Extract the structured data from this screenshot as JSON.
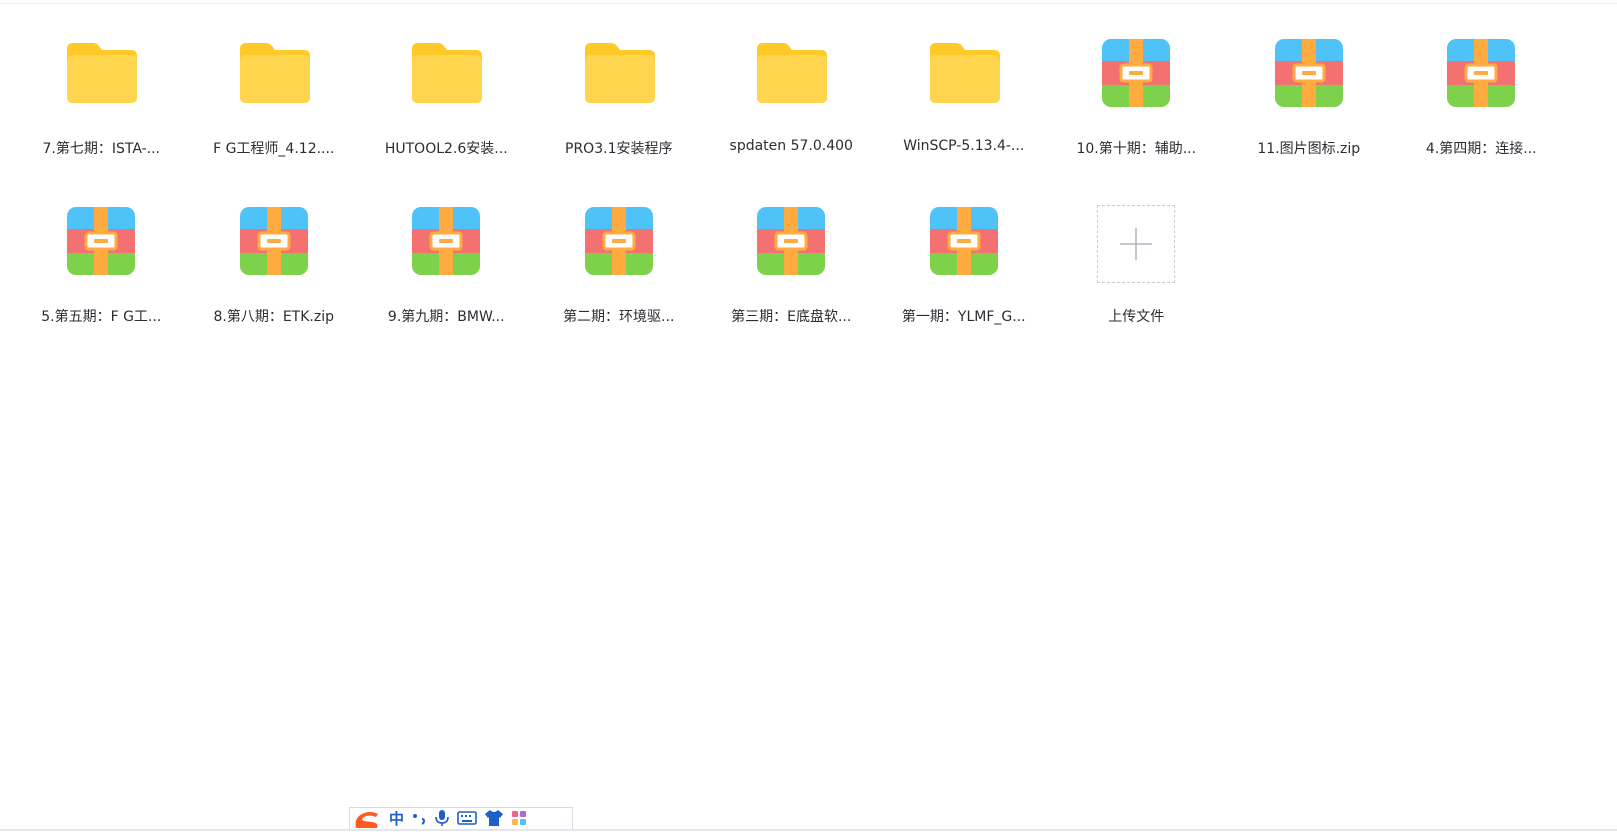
{
  "files": [
    {
      "name": "7.第七期：ISTA-...",
      "type": "folder"
    },
    {
      "name": "F G工程师_4.12....",
      "type": "folder"
    },
    {
      "name": "HUTOOL2.6安装...",
      "type": "folder"
    },
    {
      "name": "PRO3.1安装程序",
      "type": "folder"
    },
    {
      "name": "spdaten 57.0.400",
      "type": "folder"
    },
    {
      "name": "WinSCP-5.13.4-...",
      "type": "folder"
    },
    {
      "name": "10.第十期：辅助...",
      "type": "archive"
    },
    {
      "name": "11.图片图标.zip",
      "type": "archive"
    },
    {
      "name": "4.第四期：连接...",
      "type": "archive"
    },
    {
      "name": "5.第五期：F G工...",
      "type": "archive"
    },
    {
      "name": "8.第八期：ETK.zip",
      "type": "archive"
    },
    {
      "name": "9.第九期：BMW...",
      "type": "archive"
    },
    {
      "name": "第二期：环境驱...",
      "type": "archive"
    },
    {
      "name": "第三期：E底盘软...",
      "type": "archive"
    },
    {
      "name": "第一期：YLMF_G...",
      "type": "archive"
    }
  ],
  "upload": {
    "label": "上传文件"
  },
  "ime": {
    "mode_label": "中"
  },
  "colors": {
    "folder": "#ffd54f",
    "folder_tab": "#ffca28",
    "archive_top": "#4fc3f7",
    "archive_mid": "#f47171",
    "archive_bottom": "#7ed14b",
    "archive_strap": "#ffab40"
  }
}
